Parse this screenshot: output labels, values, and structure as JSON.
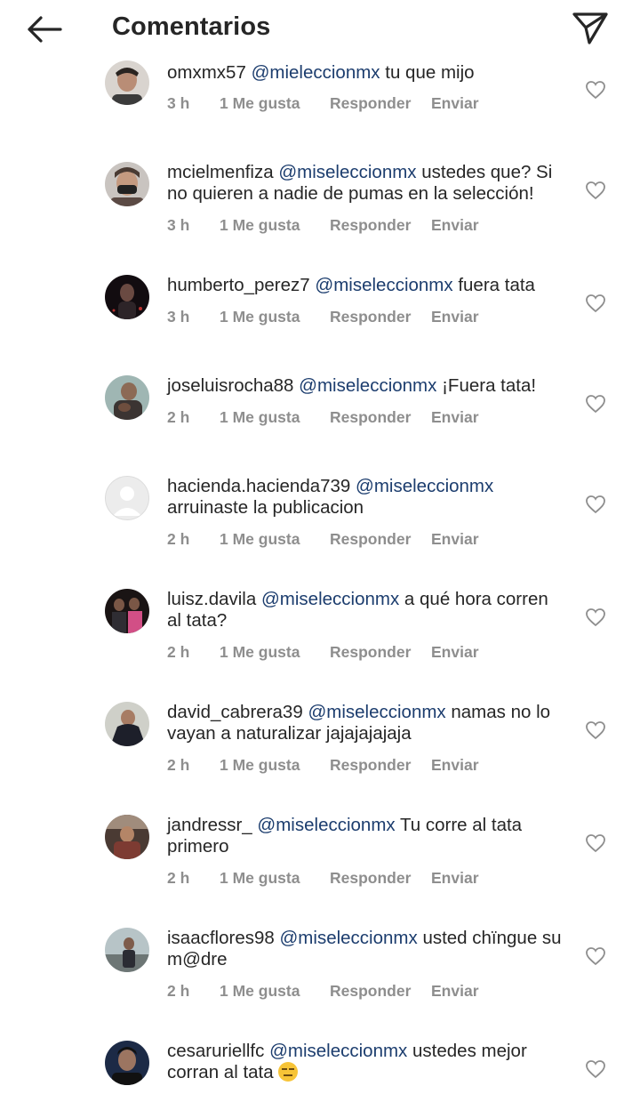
{
  "header": {
    "title": "Comentarios"
  },
  "comments": [
    {
      "username": "omxmx57",
      "mention": "@mieleccionmx",
      "body": "tu que mijo",
      "time": "3 h",
      "likes": "1 Me gusta",
      "reply": "Responder",
      "send": "Enviar"
    },
    {
      "username": "mcielmenfiza",
      "mention": "@miseleccionmx",
      "body": "ustedes que? Si no quieren a nadie de pumas en la selección!",
      "time": "3 h",
      "likes": "1 Me gusta",
      "reply": "Responder",
      "send": "Enviar"
    },
    {
      "username": "humberto_perez7",
      "mention": "@miseleccionmx",
      "body": "fuera tata",
      "time": "3 h",
      "likes": "1 Me gusta",
      "reply": "Responder",
      "send": "Enviar"
    },
    {
      "username": "joseluisrocha88",
      "mention": "@miseleccionmx",
      "body": "¡Fuera tata!",
      "time": "2 h",
      "likes": "1 Me gusta",
      "reply": "Responder",
      "send": "Enviar"
    },
    {
      "username": "hacienda.hacienda739",
      "mention": "@miseleccionmx",
      "body": "arruinaste la publicacion",
      "time": "2 h",
      "likes": "1 Me gusta",
      "reply": "Responder",
      "send": "Enviar"
    },
    {
      "username": "luisz.davila",
      "mention": "@miseleccionmx",
      "body": "a qué hora corren al tata?",
      "time": "2 h",
      "likes": "1 Me gusta",
      "reply": "Responder",
      "send": "Enviar"
    },
    {
      "username": "david_cabrera39",
      "mention": "@miseleccionmx",
      "body": "namas no lo vayan a naturalizar jajajajajaja",
      "time": "2 h",
      "likes": "1 Me gusta",
      "reply": "Responder",
      "send": "Enviar"
    },
    {
      "username": "jandressr_",
      "mention": "@miseleccionmx",
      "body": "Tu corre al tata primero",
      "time": "2 h",
      "likes": "1 Me gusta",
      "reply": "Responder",
      "send": "Enviar"
    },
    {
      "username": "isaacflores98",
      "mention": "@miseleccionmx",
      "body": "usted chïngue su m@dre",
      "time": "2 h",
      "likes": "1 Me gusta",
      "reply": "Responder",
      "send": "Enviar"
    },
    {
      "username": "cesaruriellfc",
      "mention": "@miseleccionmx",
      "body": "ustedes mejor corran al tata",
      "time": "",
      "likes": "",
      "reply": "",
      "send": ""
    }
  ],
  "icons": {
    "back": "arrow-left-icon",
    "share": "paper-plane-icon",
    "like": "heart-outline-icon",
    "emoji": "expressionless-face-emoji"
  },
  "colors": {
    "mention": "#1c3d6e",
    "meta": "#8e8e8e",
    "text": "#262626"
  }
}
